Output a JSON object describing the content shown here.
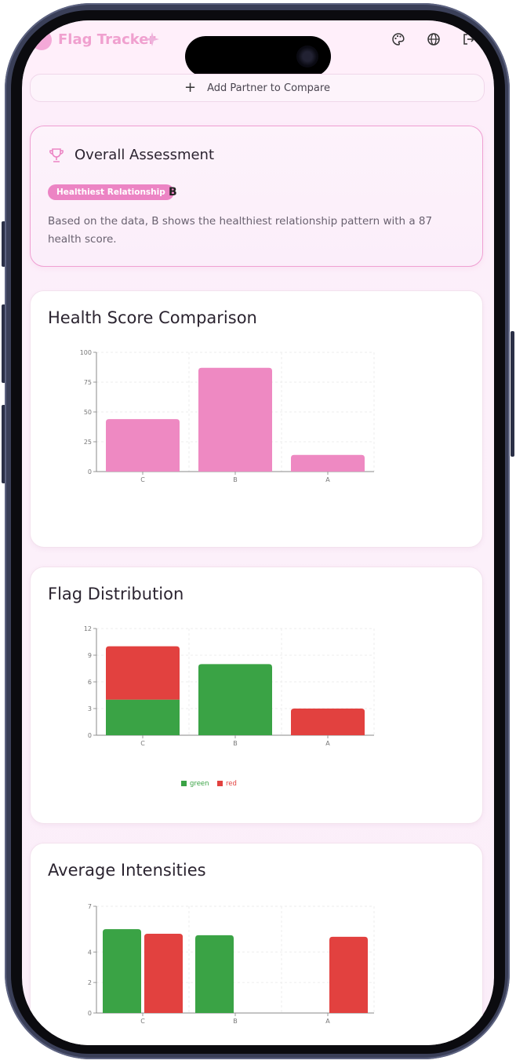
{
  "app": {
    "title": "Flag Tracker",
    "icons": [
      "palette-icon",
      "globe-icon",
      "logout-icon"
    ]
  },
  "add_partner": {
    "label": "Add Partner to Compare",
    "icon": "plus-icon"
  },
  "assessment": {
    "title": "Overall Assessment",
    "icon": "trophy-icon",
    "badge": "Healthiest Relationship",
    "winner": "B",
    "description": "Based on the data, B shows the healthiest relationship pattern with a 87 health score."
  },
  "colors": {
    "pink": "#ee89c2",
    "green": "#3aa345",
    "red": "#e2413f",
    "accent": "#ec84c4"
  },
  "chart_data": [
    {
      "type": "bar",
      "title": "Health Score Comparison",
      "categories": [
        "C",
        "B",
        "A"
      ],
      "series": [
        {
          "values": [
            44,
            87,
            14
          ]
        }
      ],
      "ylim": [
        0,
        100
      ],
      "yticks": [
        "0",
        "25",
        "50",
        "75",
        "100"
      ],
      "legend": false,
      "grid": true
    },
    {
      "type": "bar",
      "stacked": true,
      "title": "Flag Distribution",
      "categories": [
        "C",
        "B",
        "A"
      ],
      "series": [
        {
          "name": "green",
          "values": [
            4,
            8,
            0
          ]
        },
        {
          "name": "red",
          "values": [
            6,
            0,
            3
          ]
        }
      ],
      "ylim": [
        0,
        12
      ],
      "yticks": [
        "0",
        "3",
        "6",
        "9",
        "12"
      ],
      "legend": "bottom",
      "grid": true
    },
    {
      "type": "bar",
      "title": "Average Intensities",
      "categories": [
        "C",
        "B",
        "A"
      ],
      "series": [
        {
          "values": [
            5.5,
            5.1,
            null
          ]
        },
        {
          "values": [
            5.2,
            null,
            5.0
          ]
        }
      ],
      "ylim": [
        0,
        7
      ],
      "yticks": [
        "0",
        "2",
        "4",
        "7"
      ],
      "legend": false,
      "grid": true
    }
  ]
}
